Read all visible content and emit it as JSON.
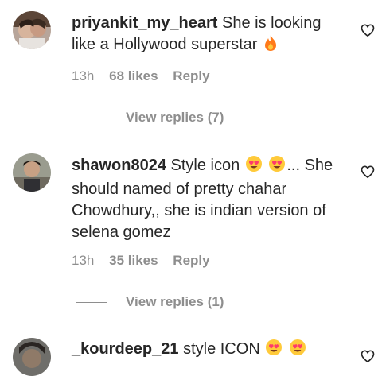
{
  "comments": [
    {
      "username": "priyankit_my_heart",
      "text": "She is looking like a Hollywood superstar",
      "emoji": "fire",
      "time": "13h",
      "likes": "68 likes",
      "reply_label": "Reply",
      "view_replies": "View replies (7)"
    },
    {
      "username": "shawon8024",
      "text_before": "Style icon",
      "text_after": "... She should named of pretty chahar Chowdhury,, she is indian version of selena gomez",
      "emoji": "heart-eyes",
      "time": "13h",
      "likes": "35 likes",
      "reply_label": "Reply",
      "view_replies": "View replies (1)"
    },
    {
      "username": "_kourdeep_21",
      "text": "style ICON",
      "emoji": "heart-eyes"
    }
  ],
  "colors": {
    "text": "#262626",
    "muted": "#8e8e8e",
    "fire": "#ff7a1a",
    "heart_eyes": "#ff3a6b"
  }
}
